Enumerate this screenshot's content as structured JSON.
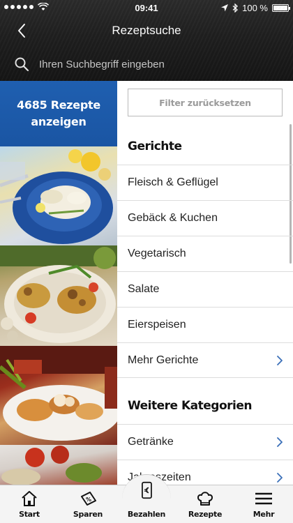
{
  "status_bar": {
    "time": "09:41",
    "battery": "100 %"
  },
  "nav": {
    "title": "Rezeptsuche"
  },
  "search": {
    "placeholder": "Ihren Suchbegriff eingeben"
  },
  "cta": {
    "line1": "4685 Rezepte",
    "line2": "anzeigen",
    "color": "#1f5fb0"
  },
  "filter": {
    "reset_label": "Filter zurücksetzen"
  },
  "sections": {
    "gerichte": {
      "title": "Gerichte",
      "items": [
        "Fleisch & Geflügel",
        "Gebäck & Kuchen",
        "Vegetarisch",
        "Salate",
        "Eierspeisen",
        "Mehr Gerichte"
      ]
    },
    "weitere": {
      "title": "Weitere Kategorien",
      "items": [
        "Getränke",
        "Jahreszeiten"
      ]
    }
  },
  "tabbar": {
    "tabs": [
      {
        "label": "Start",
        "icon": "home-icon"
      },
      {
        "label": "Sparen",
        "icon": "coupon-icon"
      },
      {
        "label": "Bezahlen",
        "icon": "phone-euro-icon"
      },
      {
        "label": "Rezepte",
        "icon": "chef-hat-icon"
      },
      {
        "label": "Mehr",
        "icon": "menu-icon"
      }
    ]
  },
  "colors": {
    "accent_blue": "#1a55a3",
    "chevron": "#3a6fb8"
  }
}
